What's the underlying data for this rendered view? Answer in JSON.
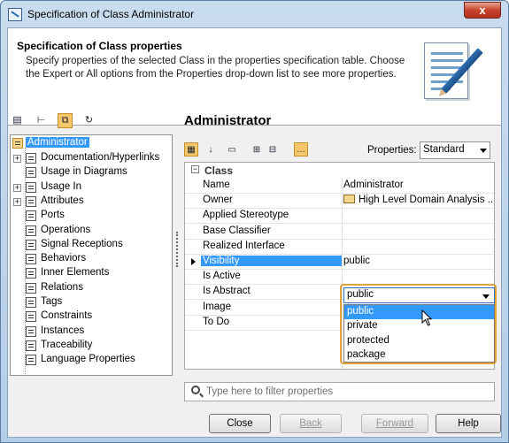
{
  "window": {
    "title": "Specification of Class Administrator",
    "close_label": "x"
  },
  "header": {
    "title": "Specification of Class properties",
    "description": "Specify properties of the selected Class in the properties specification table. Choose the Expert or All options from the Properties drop-down list to see more properties."
  },
  "left_toolbar": {
    "icons": [
      "list-view-icon",
      "tree-view-icon",
      "hierarchy-view-icon",
      "refresh-icon"
    ],
    "active_index": 2
  },
  "tree": {
    "root": "Administrator",
    "items": [
      {
        "label": "Documentation/Hyperlinks",
        "expandable": true
      },
      {
        "label": "Usage in Diagrams",
        "expandable": false
      },
      {
        "label": "Usage In",
        "expandable": true
      },
      {
        "label": "Attributes",
        "expandable": true
      },
      {
        "label": "Ports",
        "expandable": false
      },
      {
        "label": "Operations",
        "expandable": false
      },
      {
        "label": "Signal Receptions",
        "expandable": false
      },
      {
        "label": "Behaviors",
        "expandable": false
      },
      {
        "label": "Inner Elements",
        "expandable": false
      },
      {
        "label": "Relations",
        "expandable": false
      },
      {
        "label": "Tags",
        "expandable": false
      },
      {
        "label": "Constraints",
        "expandable": false
      },
      {
        "label": "Instances",
        "expandable": false
      },
      {
        "label": "Traceability",
        "expandable": false
      },
      {
        "label": "Language Properties",
        "expandable": false
      }
    ]
  },
  "right": {
    "title": "Administrator",
    "toolbar": {
      "properties_label": "Properties:",
      "properties_value": "Standard"
    },
    "section": "Class",
    "rows": [
      {
        "name": "Name",
        "value": "Administrator"
      },
      {
        "name": "Owner",
        "value": "High Level Domain Analysis ..."
      },
      {
        "name": "Applied Stereotype",
        "value": ""
      },
      {
        "name": "Base Classifier",
        "value": ""
      },
      {
        "name": "Realized Interface",
        "value": ""
      },
      {
        "name": "Visibility",
        "value": "public"
      },
      {
        "name": "Is Active",
        "value": ""
      },
      {
        "name": "Is Abstract",
        "value": ""
      },
      {
        "name": "Image",
        "value": ""
      },
      {
        "name": "To Do",
        "value": ""
      }
    ],
    "dropdown": {
      "selected": "public",
      "options": [
        "public",
        "private",
        "protected",
        "package"
      ],
      "highlighted_index": 0
    },
    "filter_placeholder": "Type here to filter properties"
  },
  "buttons": {
    "close": "Close",
    "back": "Back",
    "forward": "Forward",
    "help": "Help"
  }
}
